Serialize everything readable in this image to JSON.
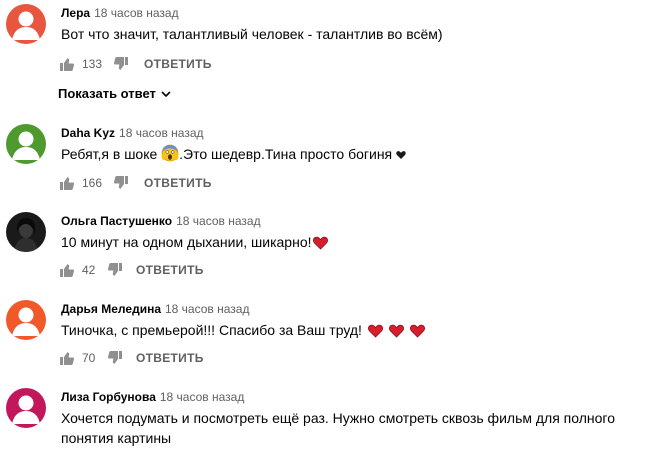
{
  "reply_label": "ОТВЕТИТЬ",
  "show_replies_label": "Показать ответ",
  "comments": [
    {
      "author": "Лера",
      "time": "18 часов назад",
      "text": "Вот что значит, талантливый человек - талантлив во всём)",
      "likes": "133",
      "avatar_color": "#e9563f"
    },
    {
      "author": "Daha Kyz",
      "time": "18 часов назад",
      "text_before": "Ребят,я в шоке",
      "text_after": ".Это шедевр.Тина просто богиня",
      "likes": "166",
      "avatar_color": "#4e9a2f"
    },
    {
      "author": "Ольга Пастушенко",
      "time": "18 часов назад",
      "text": "10 минут на одном дыхании, шикарно!",
      "likes": "42",
      "avatar_color": "#1a1a1a"
    },
    {
      "author": "Дарья Меледина",
      "time": "18 часов назад",
      "text": "Тиночка, с премьерой!!! Спасибо за Ваш труд!",
      "likes": "70",
      "avatar_color": "#f2592a"
    },
    {
      "author": "Лиза Горбунова",
      "time": "18 часов назад",
      "text": "Хочется подумать и посмотреть ещё раз. Нужно смотреть сквозь фильм для полного понятия картины",
      "avatar_color": "#c2185b"
    }
  ]
}
